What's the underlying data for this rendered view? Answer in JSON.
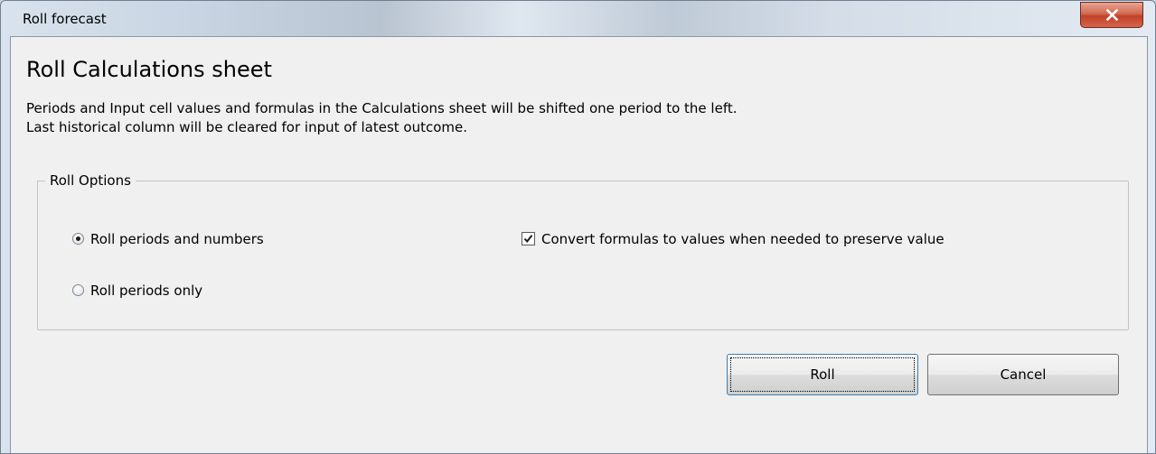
{
  "window": {
    "title": "Roll forecast",
    "close_glyph": "X"
  },
  "dialog": {
    "heading": "Roll Calculations sheet",
    "description_line1": "Periods and Input cell values and formulas in the Calculations sheet will be shifted one period to the left.",
    "description_line2": "Last historical column will be cleared for input of latest outcome."
  },
  "roll_options": {
    "legend": "Roll Options",
    "radio_options": [
      {
        "label": "Roll periods and numbers",
        "selected": true
      },
      {
        "label": "Roll periods only",
        "selected": false
      }
    ],
    "convert_checkbox": {
      "label": "Convert formulas to values when needed to preserve value",
      "checked": true
    }
  },
  "buttons": {
    "roll_label": "Roll",
    "cancel_label": "Cancel"
  },
  "colors": {
    "close_button": "#c0412a",
    "dialog_background": "#f0f0f0",
    "default_button_border": "#3c7fb1"
  }
}
